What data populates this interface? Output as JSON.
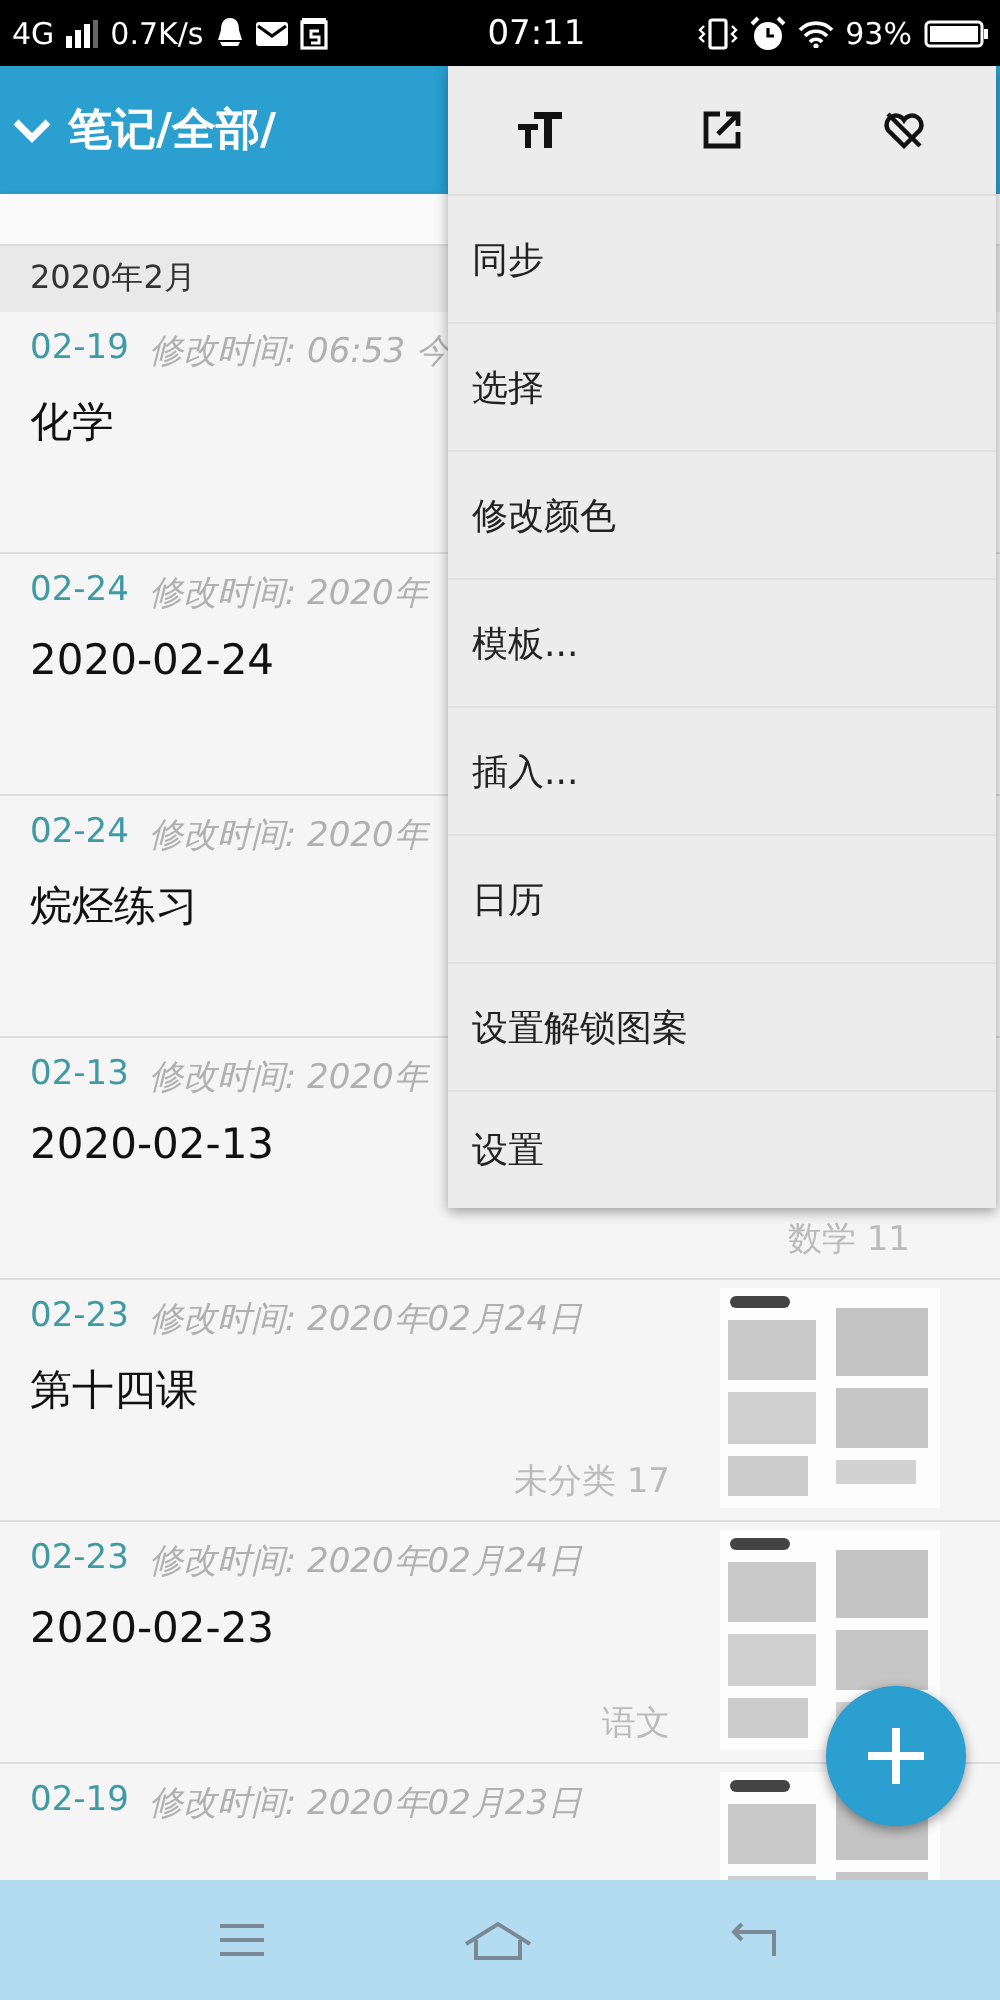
{
  "status_bar": {
    "network": "4G",
    "speed": "0.7K/s",
    "time": "07:11",
    "battery": "93%"
  },
  "header": {
    "title": "笔记/全部/"
  },
  "section": {
    "title": "2020年2月"
  },
  "notes": [
    {
      "date": "02-19",
      "modified": "修改时间: 06:53 今",
      "title": "化学"
    },
    {
      "date": "02-24",
      "modified": "修改时间: 2020年",
      "title": "2020-02-24"
    },
    {
      "date": "02-24",
      "modified": "修改时间: 2020年",
      "title": "烷烃练习"
    },
    {
      "date": "02-13",
      "modified": "修改时间: 2020年",
      "title": "2020-02-13",
      "category": "数学 11"
    },
    {
      "date": "02-23",
      "modified": "修改时间: 2020年02月24日",
      "title": "第十四课",
      "category": "未分类 17"
    },
    {
      "date": "02-23",
      "modified": "修改时间: 2020年02月24日",
      "title": "2020-02-23",
      "category": "语文"
    },
    {
      "date": "02-19",
      "modified": "修改时间: 2020年02月23日"
    }
  ],
  "menu": {
    "items": [
      "同步",
      "选择",
      "修改颜色",
      "模板...",
      "插入...",
      "日历",
      "设置解锁图案",
      "设置"
    ]
  }
}
